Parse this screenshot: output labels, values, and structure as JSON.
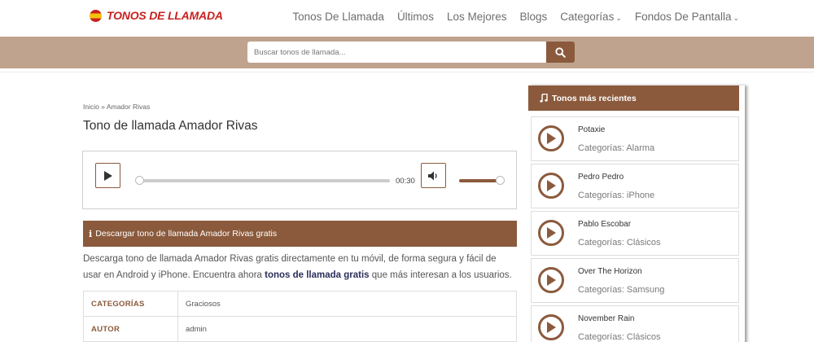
{
  "header": {
    "logo_text": "TONOS DE LLAMADA",
    "nav": [
      {
        "label": "Tonos De Llamada"
      },
      {
        "label": "Últimos"
      },
      {
        "label": "Los Mejores"
      },
      {
        "label": "Blogs"
      },
      {
        "label": "Categorías",
        "dropdown": true
      },
      {
        "label": "Fondos De Pantalla",
        "dropdown": true
      }
    ]
  },
  "search": {
    "placeholder": "Buscar tonos de llamada..."
  },
  "breadcrumb": "Inicio » Amador Rivas",
  "page_title": "Tono de llamada Amador Rivas",
  "player": {
    "time": "00:30",
    "progress": 0,
    "volume": 1
  },
  "download": {
    "label": "Descargar tono de llamada Amador Rivas gratis"
  },
  "description": {
    "text_before": "Descarga tono de llamada Amador Rivas gratis directamente en tu móvil, de forma segura y fácil de usar en Android y iPhone. Encuentra ahora ",
    "link_text": "tonos de llamada gratis",
    "text_after": " que más interesan a los usuarios."
  },
  "info_table": [
    {
      "key": "CATEGORÍAS",
      "value": "Graciosos"
    },
    {
      "key": "AUTOR",
      "value": "admin"
    }
  ],
  "sidebar": {
    "title": "Tonos más recientes",
    "items": [
      {
        "name": "Potaxie",
        "category": "Categorías: Alarma"
      },
      {
        "name": "Pedro Pedro",
        "category": "Categorías: iPhone"
      },
      {
        "name": "Pablo Escobar",
        "category": "Categorías: Clásicos"
      },
      {
        "name": "Over The Horizon",
        "category": "Categorías: Samsung"
      },
      {
        "name": "November Rain",
        "category": "Categorías: Clásicos"
      }
    ]
  },
  "colors": {
    "brand": "#8b5a3c",
    "search_band": "#bfa38e",
    "logo_red": "#c9211e"
  }
}
